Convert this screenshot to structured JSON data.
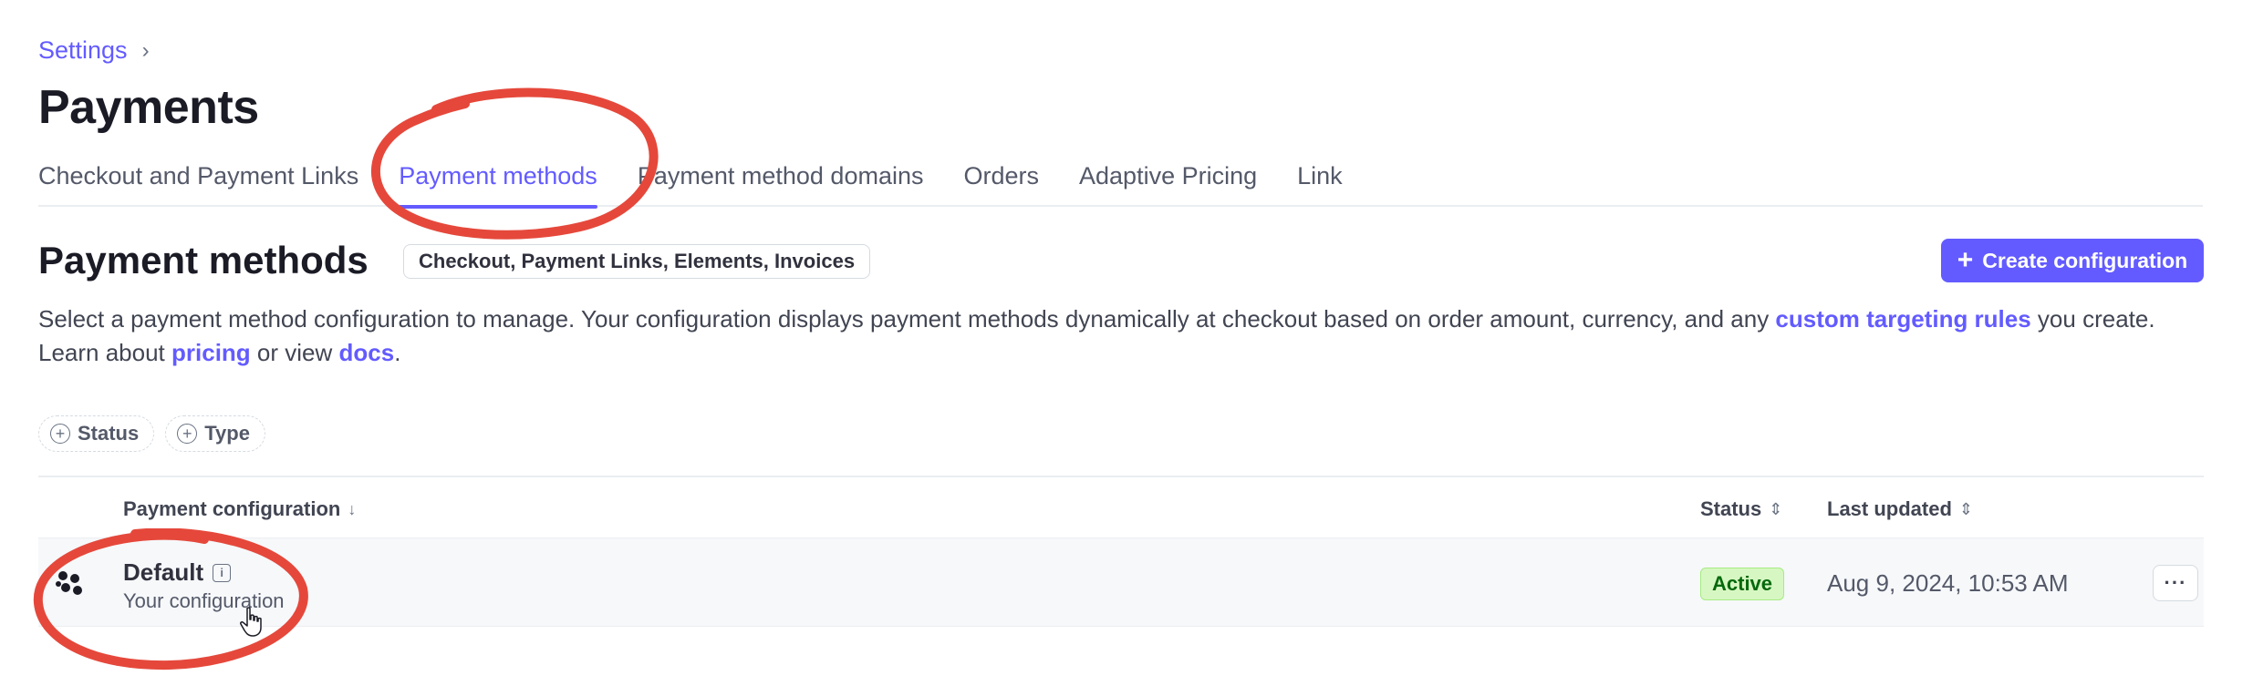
{
  "breadcrumb": {
    "link": "Settings",
    "separator": "›"
  },
  "page_title": "Payments",
  "tabs": [
    {
      "label": "Checkout and Payment Links"
    },
    {
      "label": "Payment methods",
      "active": true
    },
    {
      "label": "Payment method domains"
    },
    {
      "label": "Orders"
    },
    {
      "label": "Adaptive Pricing"
    },
    {
      "label": "Link"
    }
  ],
  "section": {
    "title": "Payment methods",
    "scope_badge": "Checkout, Payment Links, Elements, Invoices",
    "create_button": {
      "icon": "+",
      "label": "Create configuration"
    },
    "description": {
      "part1": "Select a payment method configuration to manage. Your configuration displays payment methods dynamically at checkout based on order amount, currency, and any ",
      "link1": "custom targeting rules",
      "part2": " you create. Learn about ",
      "link2": "pricing",
      "part3": " or view ",
      "link3": "docs",
      "part4": "."
    }
  },
  "filters": [
    {
      "icon": "+",
      "label": "Status"
    },
    {
      "icon": "+",
      "label": "Type"
    }
  ],
  "table": {
    "columns": {
      "config": {
        "label": "Payment configuration",
        "sort_icon": "↓"
      },
      "status": {
        "label": "Status",
        "sort_icon": "⇕"
      },
      "updated": {
        "label": "Last updated",
        "sort_icon": "⇕"
      }
    },
    "rows": [
      {
        "name": "Default",
        "info_icon": "i",
        "subtitle": "Your configuration",
        "status": "Active",
        "last_updated": "Aug 9, 2024, 10:53 AM",
        "more": "···"
      }
    ]
  },
  "colors": {
    "accent": "#635bff",
    "annotation_red": "#e5483b",
    "status_green_bg": "#d7f7c2",
    "status_green_text": "#05690d"
  },
  "icons": {
    "row_icon": "payment-config-dots-icon",
    "cursor": "hand-pointer-cursor-icon"
  }
}
